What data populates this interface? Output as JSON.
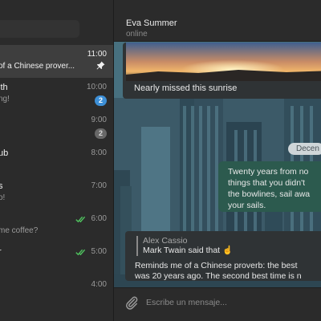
{
  "sidebar": {
    "chats": [
      {
        "title": "",
        "preview": "of a Chinese prover...",
        "time": "11:00",
        "active": true,
        "pinned": true
      },
      {
        "title": "ith",
        "preview": "ng!",
        "time": "10:00",
        "badge": "2",
        "badge_color": "blue"
      },
      {
        "title": "",
        "preview": "",
        "time": "9:00",
        "badge": "2",
        "badge_color": "gray"
      },
      {
        "title": "ub",
        "preview": "",
        "time": "8:00"
      },
      {
        "title": "s",
        "preview": "o!",
        "time": "7:00"
      },
      {
        "title": "",
        "preview": "me coffee?",
        "time": "6:00",
        "read": true
      },
      {
        "title": "r",
        "preview": "",
        "time": "5:00",
        "read": true
      },
      {
        "title": "",
        "preview": "",
        "time": "4:00"
      }
    ]
  },
  "header": {
    "contact_name": "Eva Summer",
    "status": "online"
  },
  "messages": {
    "photo_caption": "Nearly missed this sunrise",
    "date_separator": "Decen",
    "quote_lines": [
      "Twenty years from no",
      "things that you didn't",
      "the bowlines, sail awa",
      "your sails."
    ],
    "reply_author": "Alex Cassio",
    "reply_snippet": "Mark Twain said that ☝️",
    "reply_body_lines": [
      "Reminds me of a Chinese proverb: the best",
      "was 20 years ago. The second best time is n"
    ]
  },
  "composer": {
    "placeholder": "Escribe un mensaje..."
  },
  "colors": {
    "sidebar_bg": "#2b2b2b",
    "active_chat_bg": "#3e3e3e",
    "chat_bg": "#3c5a68",
    "bubble_incoming": "#2f3335",
    "bubble_outgoing": "#2c5a4e",
    "badge_blue": "#3d8fd6",
    "read_check": "#4fc45f"
  },
  "icons": {
    "pin": "pin-icon",
    "read_receipt": "double-check-icon",
    "attach": "paperclip-icon"
  }
}
